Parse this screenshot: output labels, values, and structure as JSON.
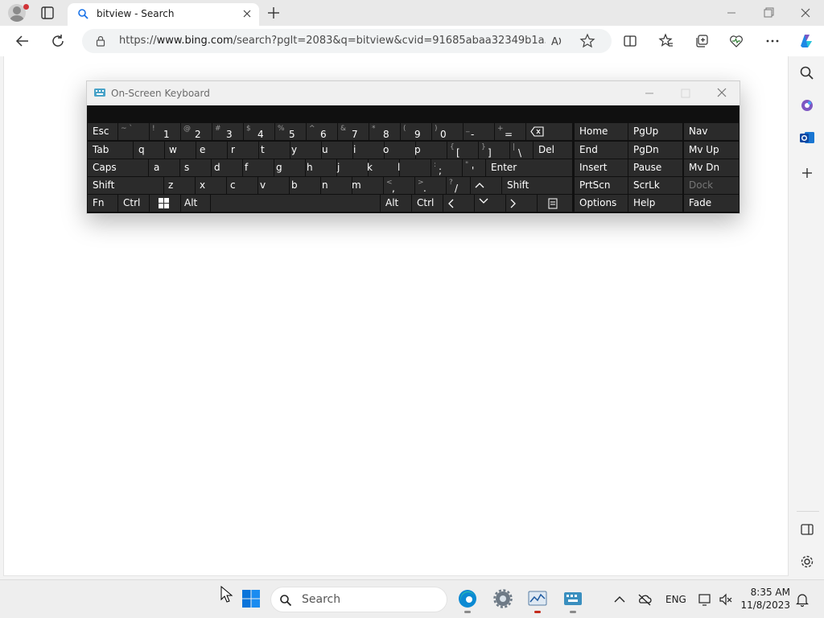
{
  "browser": {
    "tab": {
      "title": "bitview - Search"
    },
    "address": {
      "url_prefix": "https://",
      "url_host": "www.bing.com",
      "url_rest": "/search?pglt=2083&q=bitview&cvid=91685abaa32349b1a5..."
    }
  },
  "osk": {
    "title": "On-Screen Keyboard",
    "keys": {
      "esc": "Esc",
      "tab": "Tab",
      "caps": "Caps",
      "shift_l": "Shift",
      "fn": "Fn",
      "ctrl_l": "Ctrl",
      "alt_l": "Alt",
      "del": "Del",
      "enter": "Enter",
      "shift_r": "Shift",
      "alt_r": "Alt",
      "ctrl_r": "Ctrl",
      "home": "Home",
      "pgup": "PgUp",
      "nav": "Nav",
      "end": "End",
      "pgdn": "PgDn",
      "mvup": "Mv Up",
      "insert": "Insert",
      "pause": "Pause",
      "mvdn": "Mv Dn",
      "prtscn": "PrtScn",
      "scrlk": "ScrLk",
      "dock": "Dock",
      "options": "Options",
      "help": "Help",
      "fade": "Fade",
      "num": [
        {
          "sec": "~ `",
          "pri": ""
        },
        {
          "sec": "!",
          "pri": "1"
        },
        {
          "sec": "@",
          "pri": "2"
        },
        {
          "sec": "#",
          "pri": "3"
        },
        {
          "sec": "$",
          "pri": "4"
        },
        {
          "sec": "%",
          "pri": "5"
        },
        {
          "sec": "^",
          "pri": "6"
        },
        {
          "sec": "&",
          "pri": "7"
        },
        {
          "sec": "*",
          "pri": "8"
        },
        {
          "sec": "(",
          "pri": "9"
        },
        {
          "sec": ")",
          "pri": "0"
        },
        {
          "sec": "_",
          "pri": "-"
        },
        {
          "sec": "+",
          "pri": "="
        }
      ],
      "row2": [
        "q",
        "w",
        "e",
        "r",
        "t",
        "y",
        "u",
        "i",
        "o",
        "p"
      ],
      "row2_sym": [
        {
          "sec": "{",
          "pri": "["
        },
        {
          "sec": "}",
          "pri": "]"
        },
        {
          "sec": "|",
          "pri": "\\"
        }
      ],
      "row3": [
        "a",
        "s",
        "d",
        "f",
        "g",
        "h",
        "j",
        "k",
        "l"
      ],
      "row3_sym": [
        {
          "sec": ":",
          "pri": ";"
        },
        {
          "sec": "\"",
          "pri": "'"
        }
      ],
      "row4": [
        "z",
        "x",
        "c",
        "v",
        "b",
        "n",
        "m"
      ],
      "row4_sym": [
        {
          "sec": "<",
          "pri": ","
        },
        {
          "sec": ">",
          "pri": "."
        },
        {
          "sec": "?",
          "pri": "/"
        }
      ]
    }
  },
  "taskbar": {
    "search_label": "Search",
    "lang": "ENG",
    "time": "8:35 AM",
    "date": "11/8/2023"
  }
}
